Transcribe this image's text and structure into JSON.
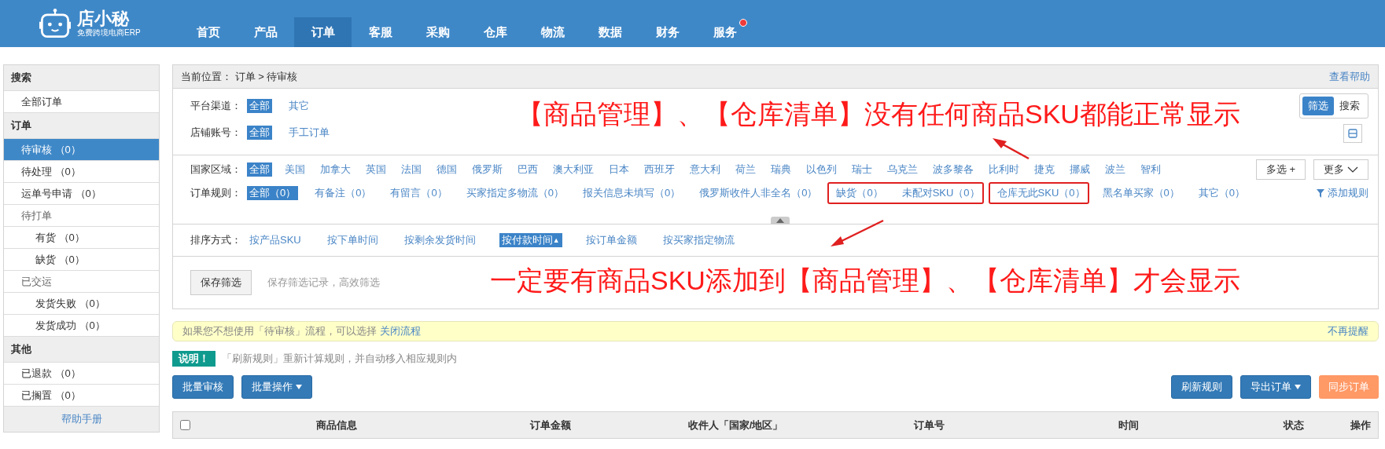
{
  "header": {
    "logo": {
      "name": "店小秘",
      "tagline": "免费跨境电商ERP"
    },
    "nav": [
      {
        "label": "首页",
        "selected": false,
        "badge": false
      },
      {
        "label": "产品",
        "selected": false,
        "badge": false
      },
      {
        "label": "订单",
        "selected": true,
        "badge": false
      },
      {
        "label": "客服",
        "selected": false,
        "badge": false
      },
      {
        "label": "采购",
        "selected": false,
        "badge": false
      },
      {
        "label": "仓库",
        "selected": false,
        "badge": false
      },
      {
        "label": "物流",
        "selected": false,
        "badge": false
      },
      {
        "label": "数据",
        "selected": false,
        "badge": false
      },
      {
        "label": "财务",
        "selected": false,
        "badge": false
      },
      {
        "label": "服务",
        "selected": false,
        "badge": true
      }
    ]
  },
  "sidebar": {
    "sections": [
      {
        "title": "搜索",
        "items": [
          {
            "label": "全部订单",
            "selected": false
          }
        ]
      },
      {
        "title": "订单",
        "items": [
          {
            "label": "待审核 （0）",
            "selected": true
          },
          {
            "label": "待处理 （0）",
            "selected": false
          },
          {
            "label": "运单号申请 （0）",
            "selected": false
          },
          {
            "label": "待打单",
            "selected": false,
            "children": [
              {
                "label": "有货 （0）",
                "selected": false
              },
              {
                "label": "缺货 （0）",
                "selected": false
              }
            ]
          },
          {
            "label": "已交运",
            "selected": false,
            "children": [
              {
                "label": "发货失败 （0）",
                "selected": false
              },
              {
                "label": "发货成功 （0）",
                "selected": false
              }
            ]
          }
        ]
      },
      {
        "title": "其他",
        "items": [
          {
            "label": "已退款 （0）",
            "selected": false
          },
          {
            "label": "已搁置 （0）",
            "selected": false
          }
        ]
      }
    ],
    "help_link": "帮助手册"
  },
  "breadcrumb": {
    "label": "当前位置：",
    "path": "订单 > 待审核",
    "help": "查看帮助"
  },
  "view_toggle": [
    {
      "label": "筛选",
      "selected": true
    },
    {
      "label": "搜索",
      "selected": false
    }
  ],
  "source_filters": [
    {
      "label": "平台渠道：",
      "options": [
        {
          "label": "全部",
          "selected": true
        },
        {
          "label": "其它",
          "selected": false
        }
      ]
    },
    {
      "label": "店铺账号：",
      "options": [
        {
          "label": "全部",
          "selected": true
        },
        {
          "label": "手工订单",
          "selected": false
        }
      ]
    }
  ],
  "country_filter": {
    "label": "国家区域：",
    "options": [
      {
        "label": "全部",
        "selected": true
      },
      {
        "label": "美国",
        "selected": false
      },
      {
        "label": "加拿大",
        "selected": false
      },
      {
        "label": "英国",
        "selected": false
      },
      {
        "label": "法国",
        "selected": false
      },
      {
        "label": "德国",
        "selected": false
      },
      {
        "label": "俄罗斯",
        "selected": false
      },
      {
        "label": "巴西",
        "selected": false
      },
      {
        "label": "澳大利亚",
        "selected": false
      },
      {
        "label": "日本",
        "selected": false
      },
      {
        "label": "西班牙",
        "selected": false
      },
      {
        "label": "意大利",
        "selected": false
      },
      {
        "label": "荷兰",
        "selected": false
      },
      {
        "label": "瑞典",
        "selected": false
      },
      {
        "label": "以色列",
        "selected": false
      },
      {
        "label": "瑞士",
        "selected": false
      },
      {
        "label": "乌克兰",
        "selected": false
      },
      {
        "label": "波多黎各",
        "selected": false
      },
      {
        "label": "比利时",
        "selected": false
      },
      {
        "label": "捷克",
        "selected": false
      },
      {
        "label": "挪威",
        "selected": false
      },
      {
        "label": "波兰",
        "selected": false
      },
      {
        "label": "智利",
        "selected": false
      }
    ],
    "multi_select": "多选 +",
    "more": "更多"
  },
  "rule_filter": {
    "label": "订单规则：",
    "entries": [
      {
        "kind": "option",
        "label": "全部（0）",
        "selected": true
      },
      {
        "kind": "option",
        "label": "有备注（0）",
        "selected": false
      },
      {
        "kind": "option",
        "label": "有留言（0）",
        "selected": false
      },
      {
        "kind": "option",
        "label": "买家指定多物流（0）",
        "selected": false
      },
      {
        "kind": "option",
        "label": "报关信息未填写（0）",
        "selected": false
      },
      {
        "kind": "option",
        "label": "俄罗斯收件人非全名（0）",
        "selected": false
      },
      {
        "kind": "highlight",
        "options": [
          {
            "label": "缺货（0）",
            "selected": false
          },
          {
            "label": "未配对SKU（0）",
            "selected": false
          }
        ]
      },
      {
        "kind": "highlight",
        "options": [
          {
            "label": "仓库无此SKU（0）",
            "selected": false
          }
        ]
      },
      {
        "kind": "option",
        "label": "黑名单买家（0）",
        "selected": false
      },
      {
        "kind": "option",
        "label": "其它（0）",
        "selected": false
      }
    ],
    "add_rule": "添加规则"
  },
  "sort": {
    "label": "排序方式：",
    "options": [
      {
        "label": "按产品SKU",
        "selected": false
      },
      {
        "label": "按下单时间",
        "selected": false
      },
      {
        "label": "按剩余发货时间",
        "selected": false
      },
      {
        "label": "按付款时间",
        "selected": true,
        "indicator": "▲"
      },
      {
        "label": "按订单金额",
        "selected": false
      },
      {
        "label": "按买家指定物流",
        "selected": false
      }
    ]
  },
  "save": {
    "button": "保存筛选",
    "hint": "保存筛选记录，高效筛选"
  },
  "notice": {
    "text": "如果您不想使用「待审核」流程，可以选择",
    "link": "关闭流程",
    "dismiss": "不再提醒"
  },
  "note": {
    "badge": "说明！",
    "text": "「刷新规则」重新计算规则，并自动移入相应规则内"
  },
  "actions_left": [
    {
      "label": "批量审核",
      "kind": "primary",
      "dropdown": false
    },
    {
      "label": "批量操作",
      "kind": "primary",
      "dropdown": true
    }
  ],
  "actions_right": [
    {
      "label": "刷新规则",
      "kind": "primary",
      "dropdown": false
    },
    {
      "label": "导出订单",
      "kind": "primary",
      "dropdown": true
    },
    {
      "label": "同步订单",
      "kind": "warning",
      "dropdown": false
    }
  ],
  "table": {
    "select_all": {
      "checked": false
    },
    "columns": [
      "商品信息",
      "订单金额",
      "收件人「国家/地区」",
      "订单号",
      "时间",
      "状态",
      "操作"
    ]
  },
  "annotations": [
    {
      "text": "【商品管理】、【仓库清单】没有任何商品SKU都能正常显示"
    },
    {
      "text": "一定要有商品SKU添加到【商品管理】、【仓库清单】才会显示"
    }
  ]
}
